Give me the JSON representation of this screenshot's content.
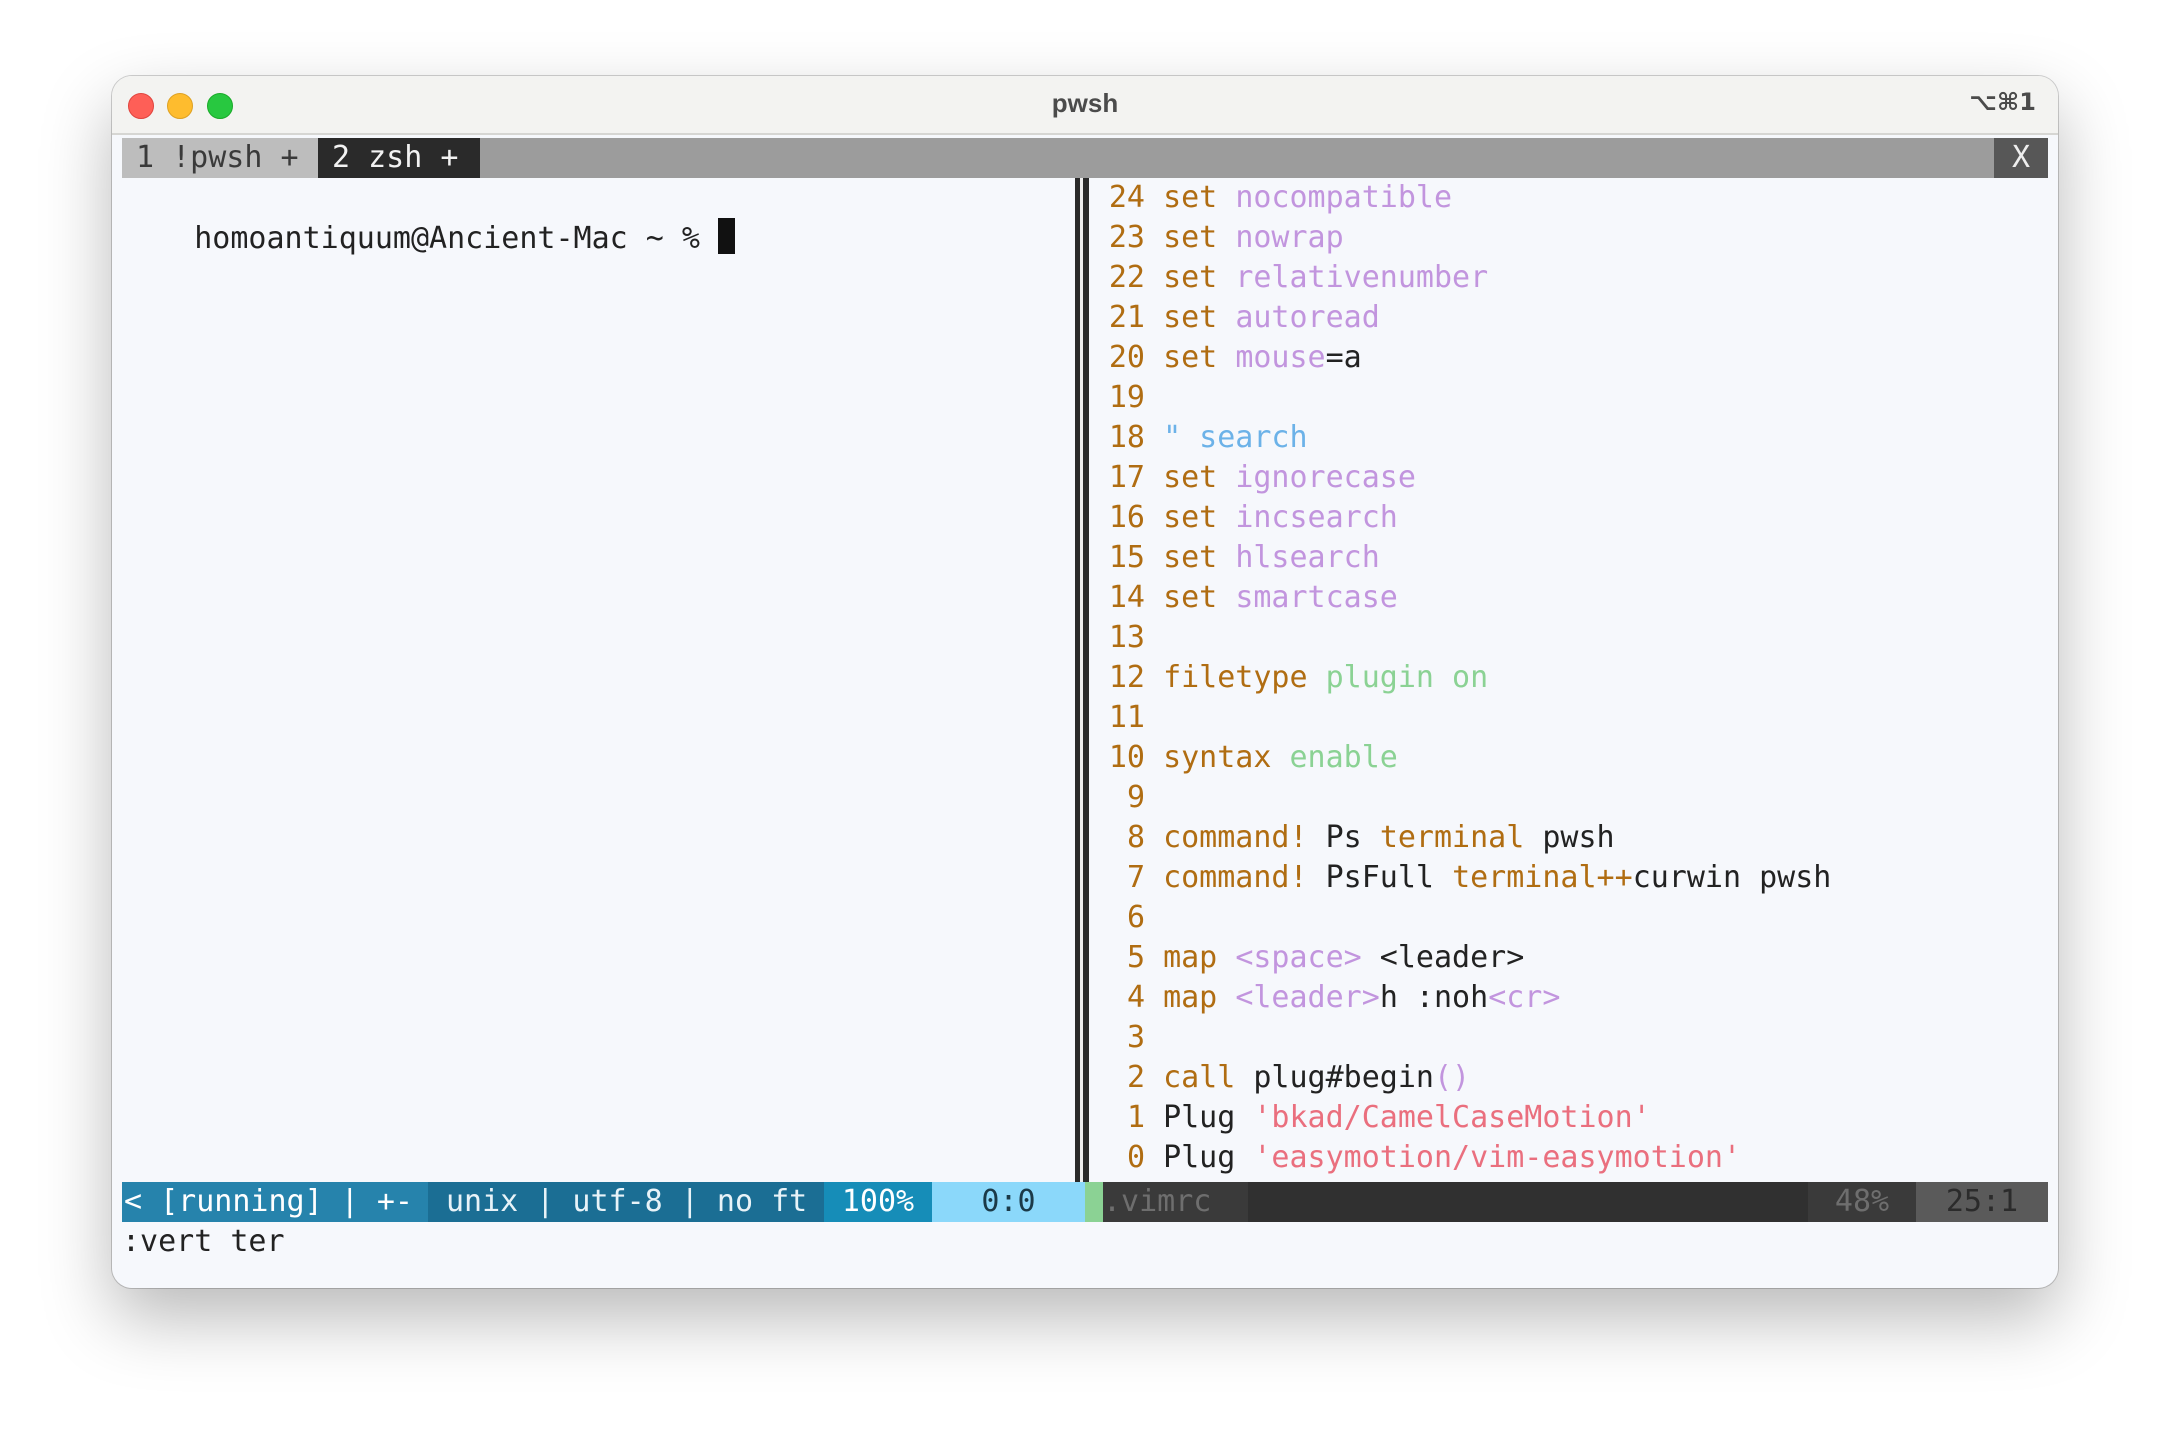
{
  "window": {
    "title": "pwsh",
    "shortcut": "⌥⌘1"
  },
  "tabline": {
    "tabs": [
      {
        "label": "1 !pwsh +"
      },
      {
        "label": "2 zsh +"
      }
    ],
    "close_label": "X"
  },
  "left_pane": {
    "prompt": "homoantiquum@Ancient-Mac ~ % "
  },
  "editor": {
    "lines": [
      {
        "num": "24",
        "parts": [
          {
            "t": "set",
            "c": "kw"
          },
          {
            "t": " ",
            "c": "txt"
          },
          {
            "t": "nocompatible",
            "c": "opt"
          }
        ]
      },
      {
        "num": "23",
        "parts": [
          {
            "t": "set",
            "c": "kw"
          },
          {
            "t": " ",
            "c": "txt"
          },
          {
            "t": "nowrap",
            "c": "opt"
          }
        ]
      },
      {
        "num": "22",
        "parts": [
          {
            "t": "set",
            "c": "kw"
          },
          {
            "t": " ",
            "c": "txt"
          },
          {
            "t": "relativenumber",
            "c": "opt"
          }
        ]
      },
      {
        "num": "21",
        "parts": [
          {
            "t": "set",
            "c": "kw"
          },
          {
            "t": " ",
            "c": "txt"
          },
          {
            "t": "autoread",
            "c": "opt"
          }
        ]
      },
      {
        "num": "20",
        "parts": [
          {
            "t": "set",
            "c": "kw"
          },
          {
            "t": " ",
            "c": "txt"
          },
          {
            "t": "mouse",
            "c": "opt"
          },
          {
            "t": "=a",
            "c": "txt"
          }
        ]
      },
      {
        "num": "19",
        "parts": []
      },
      {
        "num": "18",
        "parts": [
          {
            "t": "\" search",
            "c": "cmt"
          }
        ]
      },
      {
        "num": "17",
        "parts": [
          {
            "t": "set",
            "c": "kw"
          },
          {
            "t": " ",
            "c": "txt"
          },
          {
            "t": "ignorecase",
            "c": "opt"
          }
        ]
      },
      {
        "num": "16",
        "parts": [
          {
            "t": "set",
            "c": "kw"
          },
          {
            "t": " ",
            "c": "txt"
          },
          {
            "t": "incsearch",
            "c": "opt"
          }
        ]
      },
      {
        "num": "15",
        "parts": [
          {
            "t": "set",
            "c": "kw"
          },
          {
            "t": " ",
            "c": "txt"
          },
          {
            "t": "hlsearch",
            "c": "opt"
          }
        ]
      },
      {
        "num": "14",
        "parts": [
          {
            "t": "set",
            "c": "kw"
          },
          {
            "t": " ",
            "c": "txt"
          },
          {
            "t": "smartcase",
            "c": "opt"
          }
        ]
      },
      {
        "num": "13",
        "parts": []
      },
      {
        "num": "12",
        "parts": [
          {
            "t": "filetype",
            "c": "kw"
          },
          {
            "t": " ",
            "c": "txt"
          },
          {
            "t": "plugin on",
            "c": "grn"
          }
        ]
      },
      {
        "num": "11",
        "parts": []
      },
      {
        "num": "10",
        "parts": [
          {
            "t": "syntax",
            "c": "kw"
          },
          {
            "t": " ",
            "c": "txt"
          },
          {
            "t": "enable",
            "c": "grn"
          }
        ]
      },
      {
        "num": "9",
        "parts": []
      },
      {
        "num": "8",
        "parts": [
          {
            "t": "command!",
            "c": "kw"
          },
          {
            "t": " Ps ",
            "c": "txt"
          },
          {
            "t": "terminal",
            "c": "kw"
          },
          {
            "t": " pwsh",
            "c": "txt"
          }
        ]
      },
      {
        "num": "7",
        "parts": [
          {
            "t": "command!",
            "c": "kw"
          },
          {
            "t": " PsFull ",
            "c": "txt"
          },
          {
            "t": "terminal++",
            "c": "kw"
          },
          {
            "t": "curwin pwsh",
            "c": "txt"
          }
        ]
      },
      {
        "num": "6",
        "parts": []
      },
      {
        "num": "5",
        "parts": [
          {
            "t": "map",
            "c": "kw"
          },
          {
            "t": " ",
            "c": "txt"
          },
          {
            "t": "<space>",
            "c": "opt"
          },
          {
            "t": " <leader>",
            "c": "txt"
          }
        ]
      },
      {
        "num": "4",
        "parts": [
          {
            "t": "map",
            "c": "kw"
          },
          {
            "t": " ",
            "c": "txt"
          },
          {
            "t": "<leader>",
            "c": "opt"
          },
          {
            "t": "h :noh",
            "c": "txt"
          },
          {
            "t": "<cr>",
            "c": "opt"
          }
        ]
      },
      {
        "num": "3",
        "parts": []
      },
      {
        "num": "2",
        "parts": [
          {
            "t": "call",
            "c": "kw"
          },
          {
            "t": " plug#begin",
            "c": "txt"
          },
          {
            "t": "()",
            "c": "opt"
          }
        ]
      },
      {
        "num": "1",
        "parts": [
          {
            "t": "Plug ",
            "c": "txt"
          },
          {
            "t": "'bkad/CamelCaseMotion'",
            "c": "str"
          }
        ]
      },
      {
        "num": "0",
        "parts": [
          {
            "t": "Plug ",
            "c": "txt"
          },
          {
            "t": "'easymotion/vim-easymotion'",
            "c": "str"
          }
        ]
      }
    ]
  },
  "statusline": {
    "left_mode": "< [running] | +-",
    "left_info": "unix | utf-8 | no ft",
    "left_percent": "100%",
    "left_position": "0:0",
    "right_filename": ".vimrc",
    "right_percent": "48%",
    "right_position": "25:1"
  },
  "command_line": ":vert ter",
  "colors": {
    "keyword": "#b06d12",
    "option": "#c295de",
    "comment": "#6cb2e8",
    "green": "#8bd294",
    "string": "#ea6f7e"
  }
}
